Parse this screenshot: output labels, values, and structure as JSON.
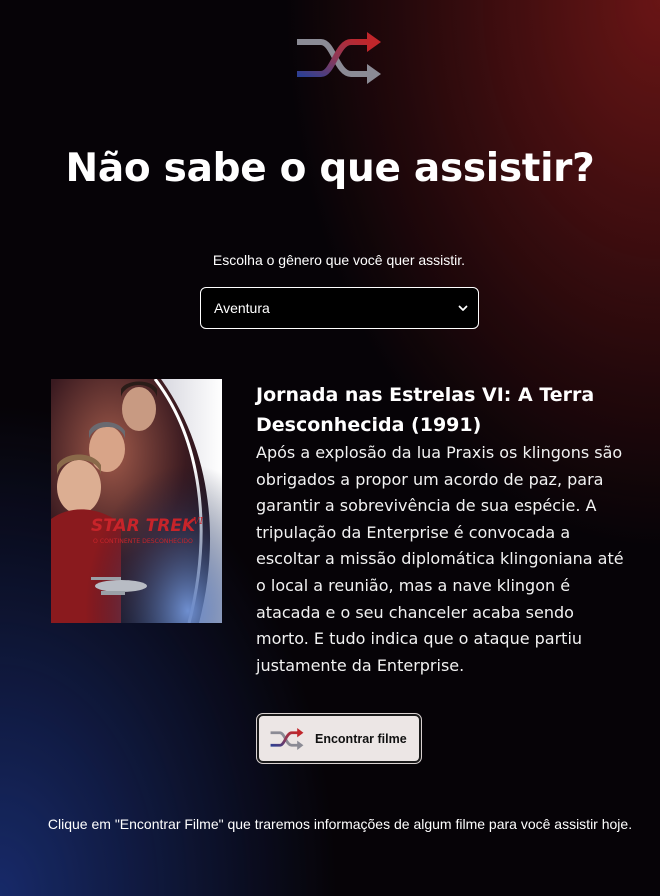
{
  "header": {
    "logo_icon": "shuffle-icon",
    "title": "Não sabe o que assistir?"
  },
  "genre": {
    "prompt": "Escolha o gênero que você quer assistir.",
    "selected": "Aventura"
  },
  "movie": {
    "title": "Jornada nas Estrelas VI: A Terra Desconhecida (1991)",
    "description": "Após a explosão da lua Praxis os klingons são obrigados a propor um acordo de paz, para garantir a sobrevivência de sua espécie. A tripulação da Enterprise é convocada a escoltar a missão diplomática klingoniana até o local a reunião, mas a nave klingon é atacada e o seu chanceler acaba sendo morto. E tudo indica que o ataque partiu justamente da Enterprise.",
    "poster": {
      "brand": "STAR TREK",
      "numeral": "VI",
      "subtitle": "O CONTINENTE DESCONHECIDO"
    }
  },
  "actions": {
    "find_label": "Encontrar filme",
    "find_icon": "shuffle-icon"
  },
  "footer": {
    "note": "Clique em \"Encontrar Filme\" que traremos informações de algum filme para você assistir hoje."
  },
  "colors": {
    "accent_red": "#c0262b",
    "accent_blue": "#2c3f93",
    "icon_grey": "#8b8b95",
    "button_bg": "#ece6e5"
  }
}
